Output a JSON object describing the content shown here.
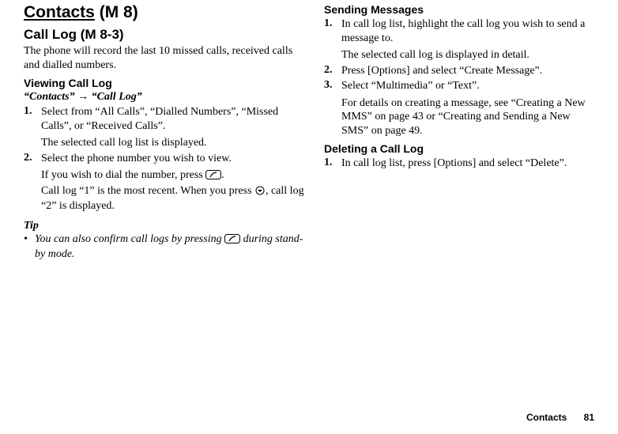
{
  "header": {
    "title": "Contacts",
    "menu_code": "(M 8)"
  },
  "left": {
    "section_title": "Call Log",
    "section_code": "(M 8-3)",
    "intro": "The phone will record the last 10 missed calls, received calls and dialled numbers.",
    "sub1_title": "Viewing Call Log",
    "nav_path_a": "“Contacts”",
    "nav_arrow": "→",
    "nav_path_b": "“Call Log”",
    "steps": [
      {
        "num": "1.",
        "text": "Select from “All Calls”, “Dialled Numbers”, “Missed Calls”, or “Received Calls”.",
        "sub": "The selected call log list is displayed."
      },
      {
        "num": "2.",
        "text": "Select the phone number you wish to view.",
        "sub_a": "If you wish to dial the number, press ",
        "sub_b": ".",
        "sub2_a": "Call log “1” is the most recent. When you press ",
        "sub2_b": ", call log “2” is displayed."
      }
    ],
    "tip_label": "Tip",
    "tip_bullet": "•",
    "tip_text_a": "You can also confirm call logs by pressing ",
    "tip_text_b": " during stand-by mode."
  },
  "right": {
    "sub1_title": "Sending Messages",
    "steps1": [
      {
        "num": "1.",
        "text": "In call log list, highlight the call log you wish to send a message to.",
        "sub": "The selected call log is displayed in detail."
      },
      {
        "num": "2.",
        "text": "Press [Options] and select “Create Message”."
      },
      {
        "num": "3.",
        "text": "Select “Multimedia” or “Text”.",
        "sub": "For details on creating a message, see “Creating a New MMS” on page 43 or “Creating and Sending a New SMS” on page 49."
      }
    ],
    "sub2_title": "Deleting a Call Log",
    "steps2": [
      {
        "num": "1.",
        "text": "In call log list, press [Options] and select “Delete”."
      }
    ]
  },
  "footer": {
    "label": "Contacts",
    "page": "81"
  }
}
